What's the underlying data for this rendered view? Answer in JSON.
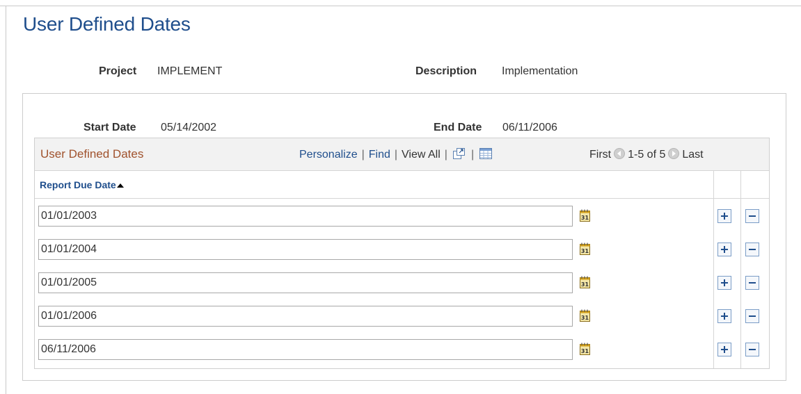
{
  "page": {
    "title": "User Defined Dates"
  },
  "header_fields": {
    "project_label": "Project",
    "project_value": "IMPLEMENT",
    "description_label": "Description",
    "description_value": "Implementation",
    "start_date_label": "Start Date",
    "start_date_value": "05/14/2002",
    "end_date_label": "End Date",
    "end_date_value": "06/11/2006"
  },
  "grid": {
    "title": "User Defined Dates",
    "personalize": "Personalize",
    "find": "Find",
    "view_all": "View All",
    "first": "First",
    "range": "1-5 of 5",
    "last": "Last",
    "column_header": "Report Due Date",
    "rows": [
      {
        "report_due_date": "01/01/2003"
      },
      {
        "report_due_date": "01/01/2004"
      },
      {
        "report_due_date": "01/01/2005"
      },
      {
        "report_due_date": "01/01/2006"
      },
      {
        "report_due_date": "06/11/2006"
      }
    ]
  },
  "icons": {
    "zoom": "zoom-grid-icon",
    "download": "download-spreadsheet-icon",
    "prev": "previous-page-icon",
    "next": "next-page-icon",
    "calendar": "calendar-icon",
    "add_row": "add-row-icon",
    "delete_row": "delete-row-icon",
    "sort": "sort-ascending-icon"
  },
  "colors": {
    "title_blue": "#1f4e8c",
    "grid_title_brown": "#a0522d",
    "calendar_gold": "#d4a017"
  }
}
